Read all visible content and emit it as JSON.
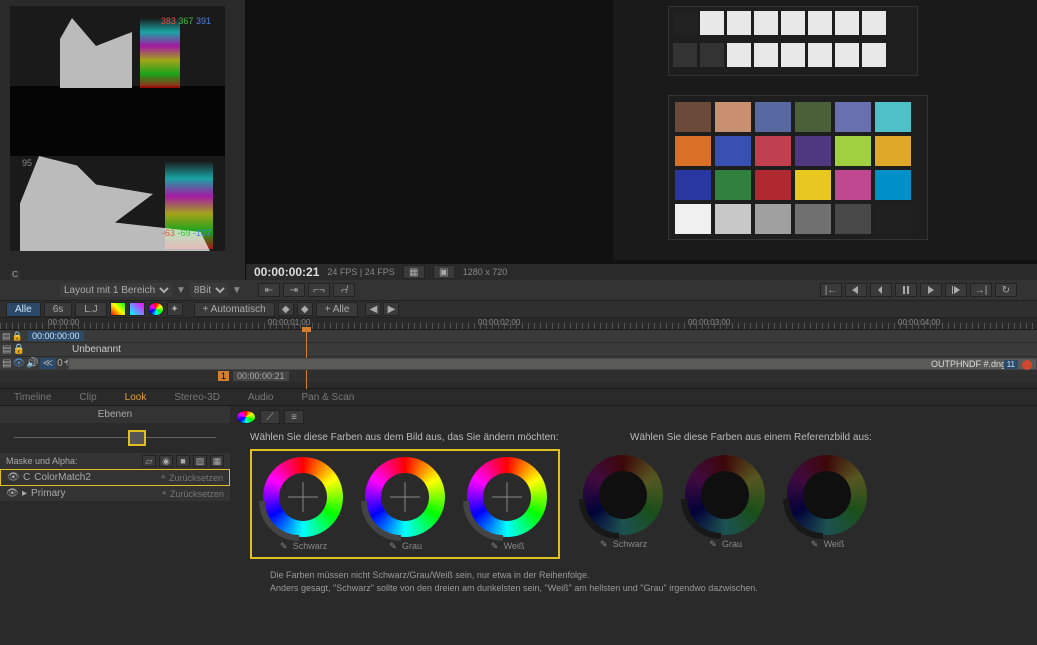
{
  "scope": {
    "top_r": "383",
    "top_g": "367",
    "top_b": "391",
    "bot_r": "-63",
    "bot_g": "-69",
    "bot_b": "-107",
    "line95": "95",
    "corner": "C",
    "layout_label": "Layout mit 1 Bereich",
    "bitdepth": "8Bit"
  },
  "viewer": {
    "timecode": "00:00:00:21",
    "info": "24 FPS  |  24 FPS",
    "res": "1280 x 720"
  },
  "filter": {
    "alle": "Alle",
    "sixs": "6s",
    "lj": "L.J",
    "auto": "+ Automatisch",
    "plus_alle": "+ Alle"
  },
  "ruler": {
    "t0": "00:00:00",
    "t1": "00:00:01:00",
    "t2": "00:00:02:00",
    "t3": "00:00:03:00",
    "t4": "00:00:04:00",
    "head_tc": "00:00:00:00"
  },
  "timeline": {
    "track_name": "Unbenannt",
    "clip_name": "OUTPHNDF #.dng",
    "sub_1": "1",
    "sub_tc": "00:00:00:21",
    "clip_zero": "0"
  },
  "tabs": {
    "timeline": "Timeline",
    "clip": "Clip",
    "look": "Look",
    "stereo": "Stereo-3D",
    "audio": "Audio",
    "pan": "Pan & Scan"
  },
  "layers": {
    "header": "Ebenen",
    "mask_label": "Maske und Alpha:",
    "item1": "ColorMatch2",
    "item2": "Primary",
    "reset": "Zurücksetzen"
  },
  "look": {
    "hdr_left": "Wählen Sie diese Farben aus dem Bild aus, das Sie ändern möchten:",
    "hdr_right": "Wählen Sie diese Farben aus einem Referenzbild aus:",
    "w1": "Schwarz",
    "w2": "Grau",
    "w3": "Weiß",
    "w4": "Schwarz",
    "w5": "Grau",
    "w6": "Weiß",
    "hint1": "Die Farben müssen nicht Schwarz/Grau/Weiß sein, nur etwa in der Reihenfolge.",
    "hint2": "Anders gesagt, \"Schwarz\" sollte von den dreien am dunkelsten sein, \"Weiß\" am hellsten und \"Grau\" irgendwo dazwischen."
  },
  "checker": {
    "row1": [
      "#6b4a3a",
      "#c89070",
      "#5868a0",
      "#4a6038",
      "#6870b0",
      "#50c0c8"
    ],
    "row2": [
      "#d87028",
      "#3850b0",
      "#c04050",
      "#503880",
      "#a0d040",
      "#e0a828"
    ],
    "row3": [
      "#2838a0",
      "#308040",
      "#b02830",
      "#e8c820",
      "#c04890",
      "#0090c8"
    ],
    "row4": [
      "#f0f0f0",
      "#c8c8c8",
      "#a0a0a0",
      "#707070",
      "#484848",
      "#202020"
    ]
  }
}
